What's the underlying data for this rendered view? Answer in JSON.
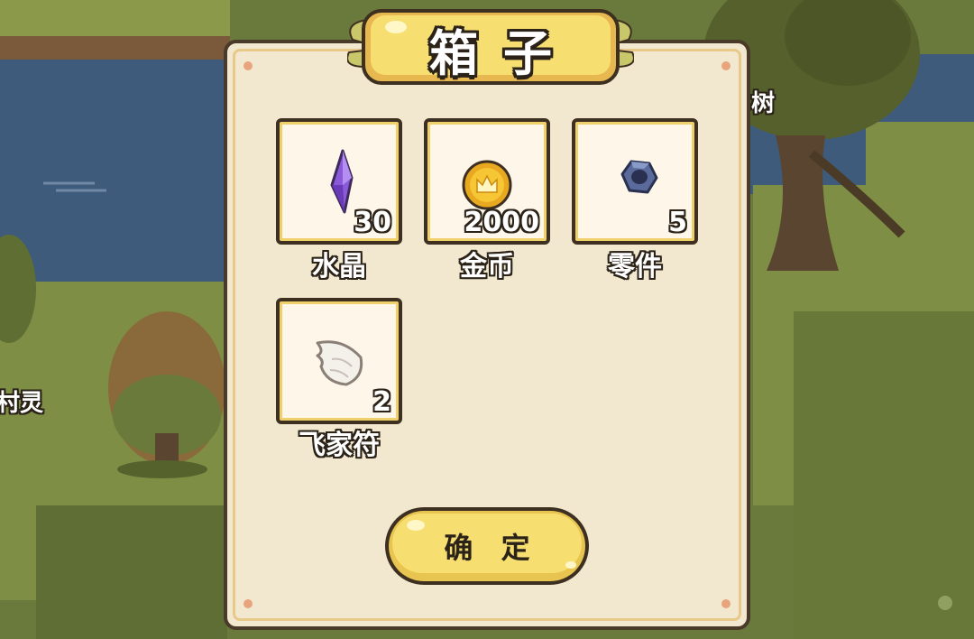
{
  "dialog": {
    "title": "箱子",
    "confirm_label": "确 定"
  },
  "items": [
    {
      "name": "水晶",
      "count": "30",
      "icon": "crystal-icon"
    },
    {
      "name": "金币",
      "count": "2000",
      "icon": "gold-coin-icon"
    },
    {
      "name": "零件",
      "count": "5",
      "icon": "hex-nut-icon"
    },
    {
      "name": "飞家符",
      "count": "2",
      "icon": "wing-icon"
    }
  ],
  "world": {
    "tree_label": "树",
    "npc_label": "村灵"
  },
  "colors": {
    "panel_bg": "#f2e8cf",
    "banner_yellow": "#f5d96a",
    "outline": "#3e3020",
    "grass": "#6b7a3c",
    "water": "#3e5a7a"
  }
}
